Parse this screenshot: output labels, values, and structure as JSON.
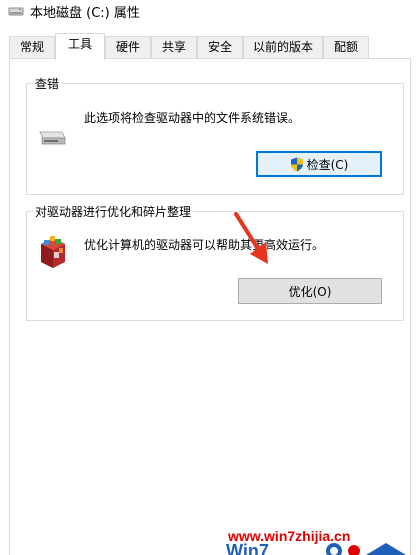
{
  "window": {
    "title": "本地磁盘 (C:) 属性"
  },
  "tabs": [
    {
      "label": "常规",
      "active": false
    },
    {
      "label": "工具",
      "active": true
    },
    {
      "label": "硬件",
      "active": false
    },
    {
      "label": "共享",
      "active": false
    },
    {
      "label": "安全",
      "active": false
    },
    {
      "label": "以前的版本",
      "active": false
    },
    {
      "label": "配额",
      "active": false
    }
  ],
  "error_check": {
    "group_title": "查错",
    "description": "此选项将检查驱动器中的文件系统错误。",
    "button_label": "检查(C)",
    "icon": "drive-icon"
  },
  "optimize": {
    "group_title": "对驱动器进行优化和碎片整理",
    "description": "优化计算机的驱动器可以帮助其更高效运行。",
    "button_label": "优化(O)",
    "icon": "defrag-icon"
  },
  "watermark": {
    "url": "www.win7zhijia.cn",
    "logo_text": "Win7"
  },
  "colors": {
    "watermark": "#e10000",
    "focus_border": "#0078d7",
    "arrow": "#e8341c"
  }
}
